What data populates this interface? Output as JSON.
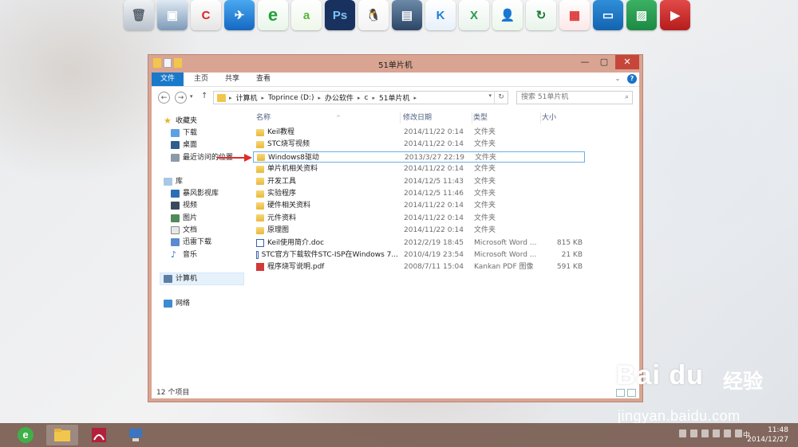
{
  "window": {
    "title": "51单片机",
    "ribbon_tabs": [
      "文件",
      "主页",
      "共享",
      "查看"
    ],
    "address": [
      "计算机",
      "Toprince (D:)",
      "办公软件",
      "c",
      "51单片机"
    ],
    "search_placeholder": "搜索 51单片机"
  },
  "nav": {
    "favorites": {
      "label": "收藏夹",
      "items": [
        "下载",
        "桌面",
        "最近访问的位置"
      ]
    },
    "libraries": {
      "label": "库",
      "items": [
        "暴风影视库",
        "视频",
        "图片",
        "文档",
        "迅雷下载",
        "音乐"
      ]
    },
    "computer": "计算机",
    "network": "网络"
  },
  "columns": {
    "name": "名称",
    "date": "修改日期",
    "type": "类型",
    "size": "大小"
  },
  "files": [
    {
      "name": "Keil教程",
      "date": "2014/11/22 0:14",
      "type": "文件夹",
      "size": "",
      "kind": "folder"
    },
    {
      "name": "STC烧写视频",
      "date": "2014/11/22 0:14",
      "type": "文件夹",
      "size": "",
      "kind": "folder"
    },
    {
      "name": "Windows8驱动",
      "date": "2013/3/27 22:19",
      "type": "文件夹",
      "size": "",
      "kind": "folder"
    },
    {
      "name": "单片机相关资料",
      "date": "2014/11/22 0:14",
      "type": "文件夹",
      "size": "",
      "kind": "folder"
    },
    {
      "name": "开发工具",
      "date": "2014/12/5 11:43",
      "type": "文件夹",
      "size": "",
      "kind": "folder"
    },
    {
      "name": "实验程序",
      "date": "2014/12/5 11:46",
      "type": "文件夹",
      "size": "",
      "kind": "folder"
    },
    {
      "name": "硬件相关资料",
      "date": "2014/11/22 0:14",
      "type": "文件夹",
      "size": "",
      "kind": "folder"
    },
    {
      "name": "元件资料",
      "date": "2014/11/22 0:14",
      "type": "文件夹",
      "size": "",
      "kind": "folder"
    },
    {
      "name": "原理图",
      "date": "2014/11/22 0:14",
      "type": "文件夹",
      "size": "",
      "kind": "folder"
    },
    {
      "name": "Keil使用简介.doc",
      "date": "2012/2/19 18:45",
      "type": "Microsoft Word ...",
      "size": "815 KB",
      "kind": "doc"
    },
    {
      "name": "STC官方下载软件STC-ISP在Windows 7...",
      "date": "2010/4/19 23:54",
      "type": "Microsoft Word ...",
      "size": "21 KB",
      "kind": "doc"
    },
    {
      "name": "程序烧写说明.pdf",
      "date": "2008/7/11 15:04",
      "type": "Kankan PDF 图像",
      "size": "591 KB",
      "kind": "pdf"
    }
  ],
  "status": {
    "count": "12 个项目"
  },
  "watermark": {
    "logo": "Bai du",
    "brand": "经验",
    "url": "jingyan.baidu.com"
  },
  "taskbar": {
    "lang": "中",
    "time": "11:48",
    "date": "2014/12/27"
  },
  "dock_icons": [
    "recycle-bin",
    "computer",
    "ccleaner",
    "feather",
    "ie",
    "a-app",
    "Ps",
    "qq",
    "film",
    "K",
    "excel-x",
    "user",
    "sync",
    "window",
    "doc",
    "image",
    "media"
  ]
}
